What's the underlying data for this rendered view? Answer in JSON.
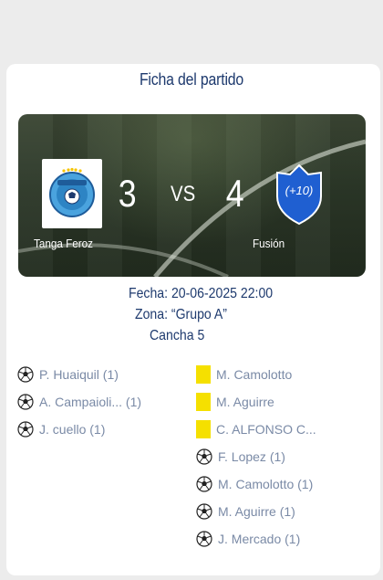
{
  "header": {
    "title": "Ficha del partido"
  },
  "match": {
    "home": {
      "name": "Tanga Feroz",
      "score": "3",
      "logo": "tanga-feroz-badge"
    },
    "away": {
      "name": "Fusión",
      "score": "4",
      "logo": "shield-plus10-badge",
      "badge_text": "(+10)"
    },
    "vs_label": "VS",
    "date_line": "Fecha: 20-06-2025 22:00",
    "zone_line": "Zona: “Grupo A”",
    "court_line": "Cancha 5"
  },
  "events": {
    "home": [
      {
        "type": "goal",
        "icon": "soccer-ball-icon",
        "text": "P. Huaiquil  (1)"
      },
      {
        "type": "goal",
        "icon": "soccer-ball-icon",
        "text": "A. Campaioli... (1)"
      },
      {
        "type": "goal",
        "icon": "soccer-ball-icon",
        "text": "J. cuello (1)"
      }
    ],
    "away": [
      {
        "type": "yellow-card",
        "icon": "yellow-card-icon",
        "text": "M. Camolotto"
      },
      {
        "type": "yellow-card",
        "icon": "yellow-card-icon",
        "text": "M. Aguirre"
      },
      {
        "type": "yellow-card",
        "icon": "yellow-card-icon",
        "text": "C. ALFONSO C..."
      },
      {
        "type": "goal",
        "icon": "soccer-ball-icon",
        "text": "F. Lopez (1)"
      },
      {
        "type": "goal",
        "icon": "soccer-ball-icon",
        "text": "M. Camolotto (1)"
      },
      {
        "type": "goal",
        "icon": "soccer-ball-icon",
        "text": "M. Aguirre (1)"
      },
      {
        "type": "goal",
        "icon": "soccer-ball-icon",
        "text": "J. Mercado (1)"
      }
    ]
  },
  "colors": {
    "title": "#1e3a6e",
    "event_text": "#7a8aa6",
    "yellow_card": "#f5e000",
    "away_shield": "#1f5fd1"
  }
}
